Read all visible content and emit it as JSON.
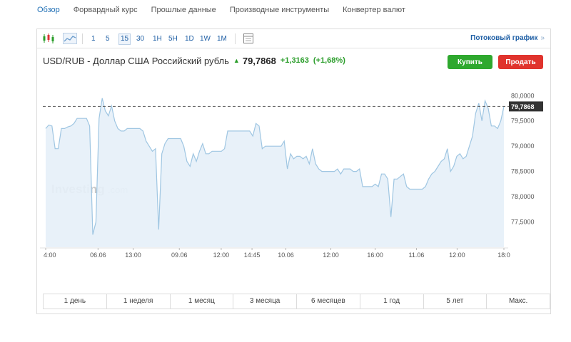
{
  "nav": {
    "items": [
      "Обзор",
      "Форвардный курс",
      "Прошлые данные",
      "Производные инструменты",
      "Конвертер валют"
    ]
  },
  "toolbar": {
    "icons": [
      "candlestick-icon",
      "area-chart-icon",
      "table-icon"
    ],
    "timeframes": [
      "1",
      "5",
      "15",
      "30",
      "1H",
      "5H",
      "1D",
      "1W",
      "1M"
    ],
    "active_timeframe": "15",
    "stream_label": "Потоковый график",
    "stream_arrow": "»"
  },
  "quote": {
    "pair": "USD/RUB - Доллар США Российский рубль",
    "price": "79,7868",
    "change": "+1,3163",
    "change_pct": "(+1,68%)",
    "up_color": "#2a9d2a"
  },
  "actions": {
    "buy_label": "Купить",
    "sell_label": "Продать"
  },
  "watermark": {
    "text": "Investing",
    "suffix": ".com"
  },
  "periods": [
    "1 день",
    "1 неделя",
    "1 месяц",
    "3 месяца",
    "6 месяцев",
    "1 год",
    "5 лет",
    "Макс."
  ],
  "chart_data": {
    "type": "area",
    "ylim": [
      77.0,
      80.3
    ],
    "y_ticks": [
      77.5,
      78.0,
      78.5,
      79.0,
      79.5,
      80.0
    ],
    "y_tick_labels": [
      "77,5000",
      "78,0000",
      "78,5000",
      "79,0000",
      "79,5000",
      "80,0000"
    ],
    "x_tick_labels": [
      "4:00",
      "06.06",
      "13:00",
      "09.06",
      "12:00",
      "14:45",
      "10.06",
      "12:00",
      "16:00",
      "11.06",
      "12:00",
      "18:0"
    ],
    "x_tick_index": [
      0,
      8.5,
      14.2,
      21.7,
      28.5,
      33.5,
      39,
      46.3,
      53.5,
      60.2,
      66.8,
      74.4
    ],
    "last_value": 79.7868,
    "last_label": "79,7868",
    "line_color": "#9fc6e2",
    "fill_color": "#e6f0f8",
    "y": [
      79.35,
      79.42,
      79.4,
      78.95,
      78.95,
      79.35,
      79.35,
      79.38,
      79.4,
      79.45,
      79.55,
      79.55,
      79.55,
      79.55,
      79.4,
      77.25,
      77.5,
      79.55,
      79.95,
      79.7,
      79.6,
      79.8,
      79.5,
      79.35,
      79.3,
      79.3,
      79.35,
      79.35,
      79.35,
      79.35,
      79.35,
      79.3,
      79.1,
      79.0,
      78.9,
      78.95,
      77.35,
      78.85,
      79.05,
      79.15,
      79.15,
      79.15,
      79.15,
      79.15,
      79.0,
      78.7,
      78.6,
      78.85,
      78.7,
      78.9,
      79.05,
      78.85,
      78.85,
      78.9,
      78.9,
      78.9,
      78.9,
      78.95,
      79.3,
      79.3,
      79.3,
      79.3,
      79.3,
      79.3,
      79.3,
      79.3,
      79.2,
      79.45,
      79.4,
      78.95,
      79.0,
      79.0,
      79.0,
      79.0,
      79.0,
      79.0,
      79.1,
      78.55,
      78.85,
      78.75,
      78.8,
      78.8,
      78.75,
      78.8,
      78.65,
      78.95,
      78.65,
      78.55,
      78.5,
      78.5,
      78.5,
      78.5,
      78.5,
      78.55,
      78.45,
      78.55,
      78.55,
      78.55,
      78.5,
      78.5,
      78.55,
      78.2,
      78.2,
      78.2,
      78.2,
      78.25,
      78.2,
      78.45,
      78.45,
      78.35,
      77.6,
      78.35,
      78.35,
      78.4,
      78.45,
      78.2,
      78.15,
      78.15,
      78.15,
      78.15,
      78.15,
      78.2,
      78.35,
      78.45,
      78.5,
      78.6,
      78.7,
      78.75,
      78.95,
      78.5,
      78.6,
      78.8,
      78.85,
      78.75,
      78.8,
      79.0,
      79.2,
      79.65,
      79.85,
      79.5,
      79.9,
      79.75,
      79.4,
      79.4,
      79.35,
      79.5,
      79.7868
    ]
  }
}
